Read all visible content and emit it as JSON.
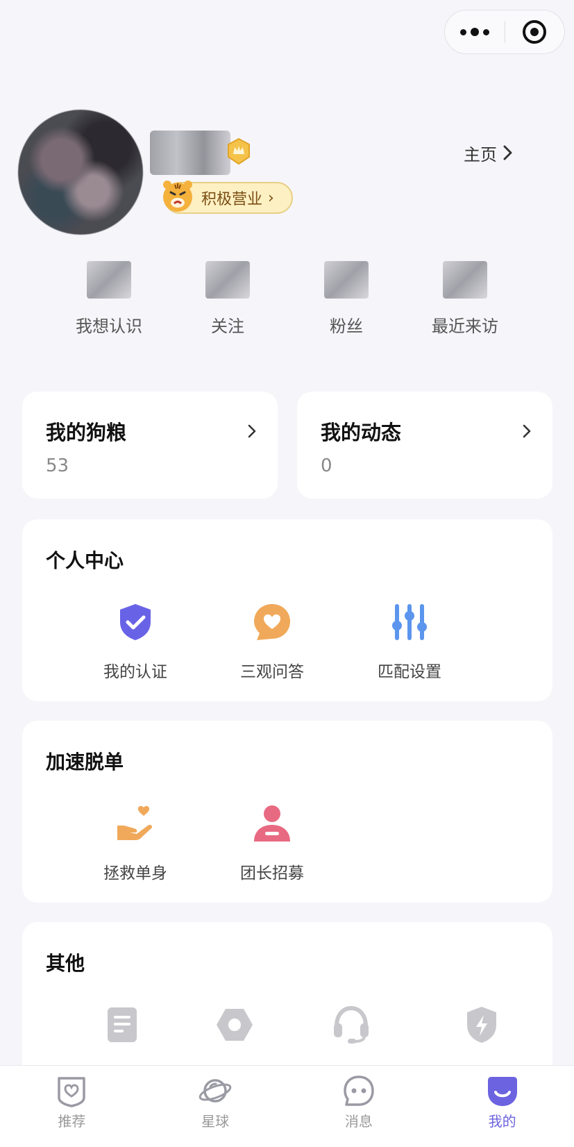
{
  "colors": {
    "accent": "#6b63e0",
    "shield": "#6863e6",
    "orange": "#f0a95a",
    "blue": "#5b95ee",
    "pink": "#e86a82",
    "gray_icon": "#c8c8cc",
    "badge_bg": "#fdf0c2"
  },
  "profile": {
    "badge_label": "积极营业",
    "homepage_label": "主页"
  },
  "stats": [
    {
      "label": "我想认识"
    },
    {
      "label": "关注"
    },
    {
      "label": "粉丝"
    },
    {
      "label": "最近来访"
    }
  ],
  "cards": {
    "dog_food": {
      "title": "我的狗粮",
      "value": "53"
    },
    "posts": {
      "title": "我的动态",
      "value": "0"
    }
  },
  "personal_center": {
    "title": "个人中心",
    "items": [
      {
        "label": "我的认证",
        "icon": "shield-check-icon"
      },
      {
        "label": "三观问答",
        "icon": "heart-chat-icon"
      },
      {
        "label": "匹配设置",
        "icon": "sliders-icon"
      }
    ]
  },
  "speed_up": {
    "title": "加速脱单",
    "items": [
      {
        "label": "拯救单身",
        "icon": "hand-heart-icon"
      },
      {
        "label": "团长招募",
        "icon": "person-badge-icon"
      }
    ]
  },
  "other": {
    "title": "其他",
    "items": [
      {
        "icon": "document-icon"
      },
      {
        "icon": "settings-hex-icon"
      },
      {
        "icon": "headset-icon"
      },
      {
        "icon": "shield-bolt-icon"
      }
    ]
  },
  "tabbar": {
    "items": [
      {
        "label": "推荐",
        "icon": "heart-tag-icon"
      },
      {
        "label": "星球",
        "icon": "planet-icon"
      },
      {
        "label": "消息",
        "icon": "chat-bubble-icon"
      },
      {
        "label": "我的",
        "icon": "smile-icon",
        "active": true
      }
    ]
  }
}
